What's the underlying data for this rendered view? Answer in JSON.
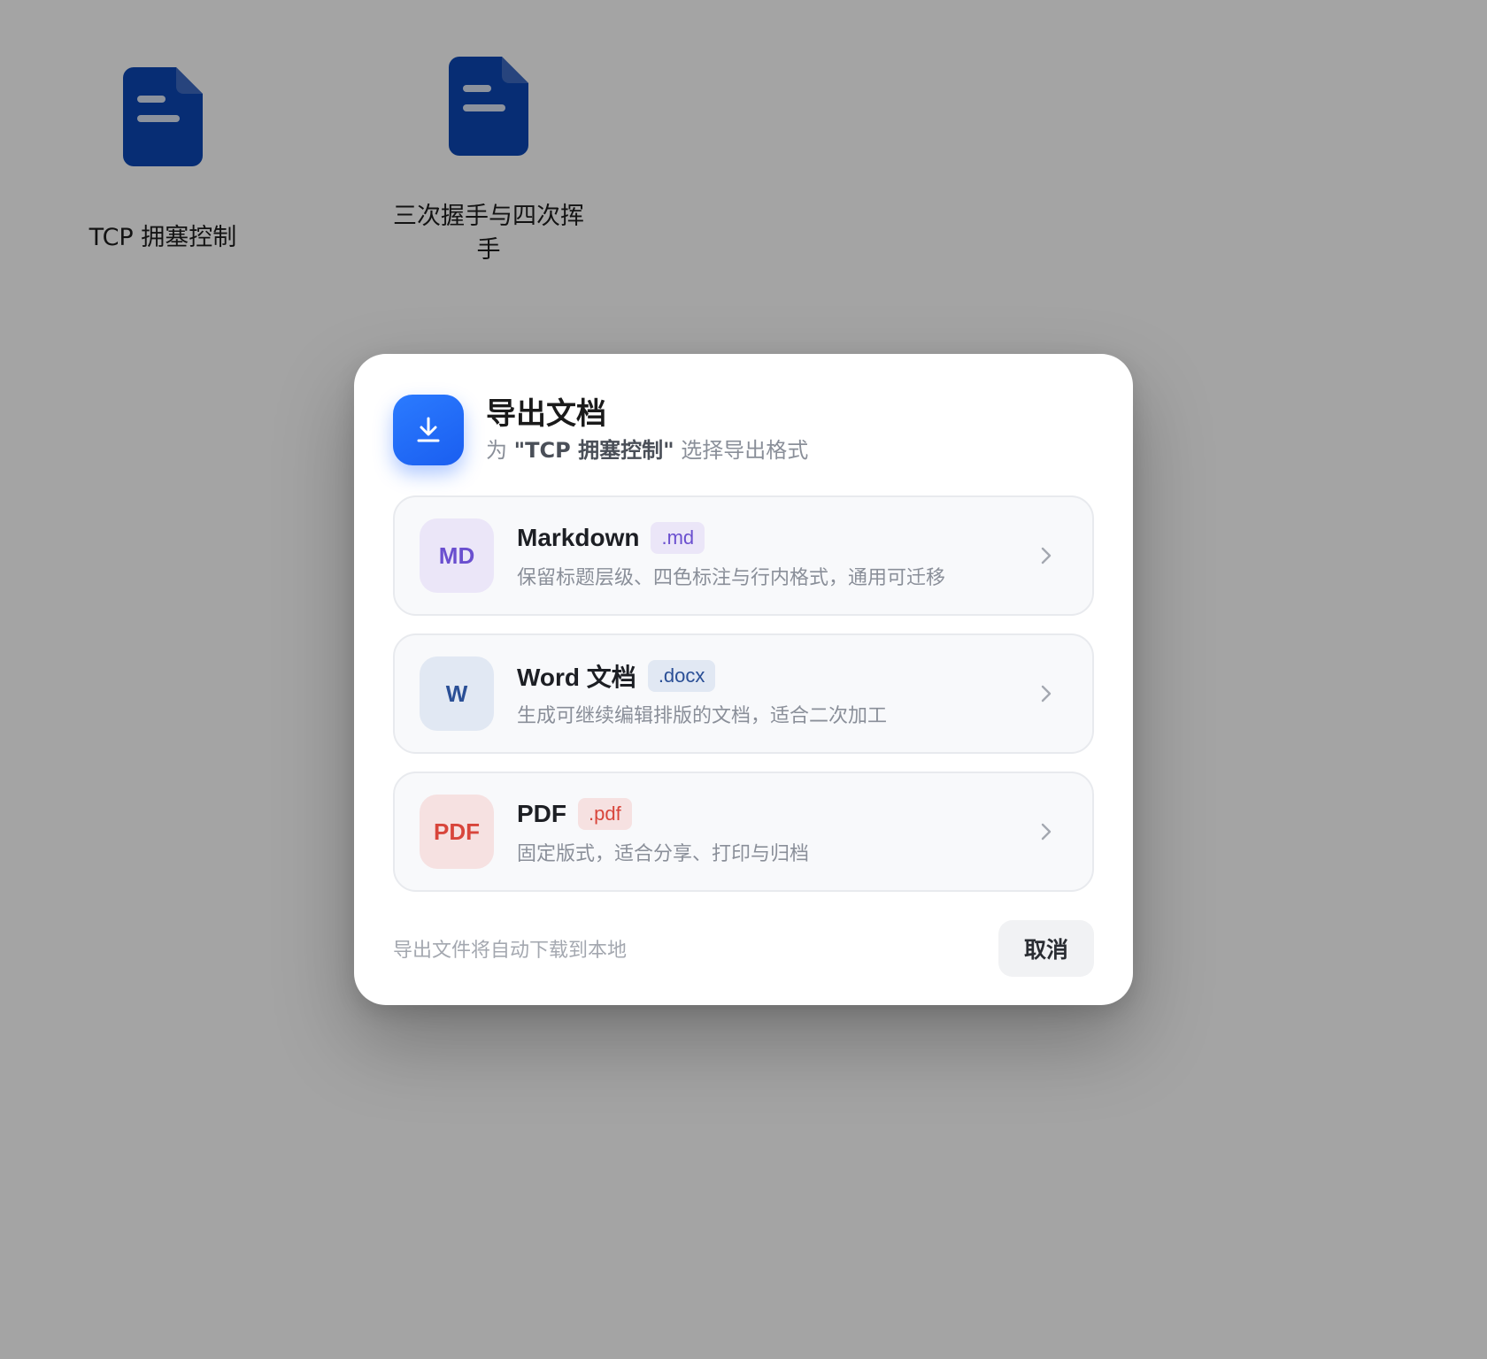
{
  "desktop": {
    "documents": [
      {
        "name": "TCP 拥塞控制",
        "icon": "document-icon"
      },
      {
        "name": "三次握手与四次挥手",
        "icon": "document-icon"
      }
    ],
    "icon_color": "#0b47b5"
  },
  "dialog": {
    "title": "导出文档",
    "subtitle_prefix": "为",
    "subtitle_doc_name": "\"TCP 拥塞控制\"",
    "subtitle_suffix": "选择导出格式",
    "header_icon": "download-icon",
    "accent_color": "#1f6bff",
    "options": [
      {
        "badge": "MD",
        "title": "Markdown",
        "ext": ".md",
        "description": "保留标题层级、四色标注与行内格式，通用可迁移",
        "color": "#6a4fcf"
      },
      {
        "badge": "W",
        "title": "Word 文档",
        "ext": ".docx",
        "description": "生成可继续编辑排版的文档，适合二次加工",
        "color": "#2a4f96"
      },
      {
        "badge": "PDF",
        "title": "PDF",
        "ext": ".pdf",
        "description": "固定版式，适合分享、打印与归档",
        "color": "#d8453b"
      }
    ],
    "footer_note": "导出文件将自动下载到本地",
    "cancel_label": "取消"
  }
}
